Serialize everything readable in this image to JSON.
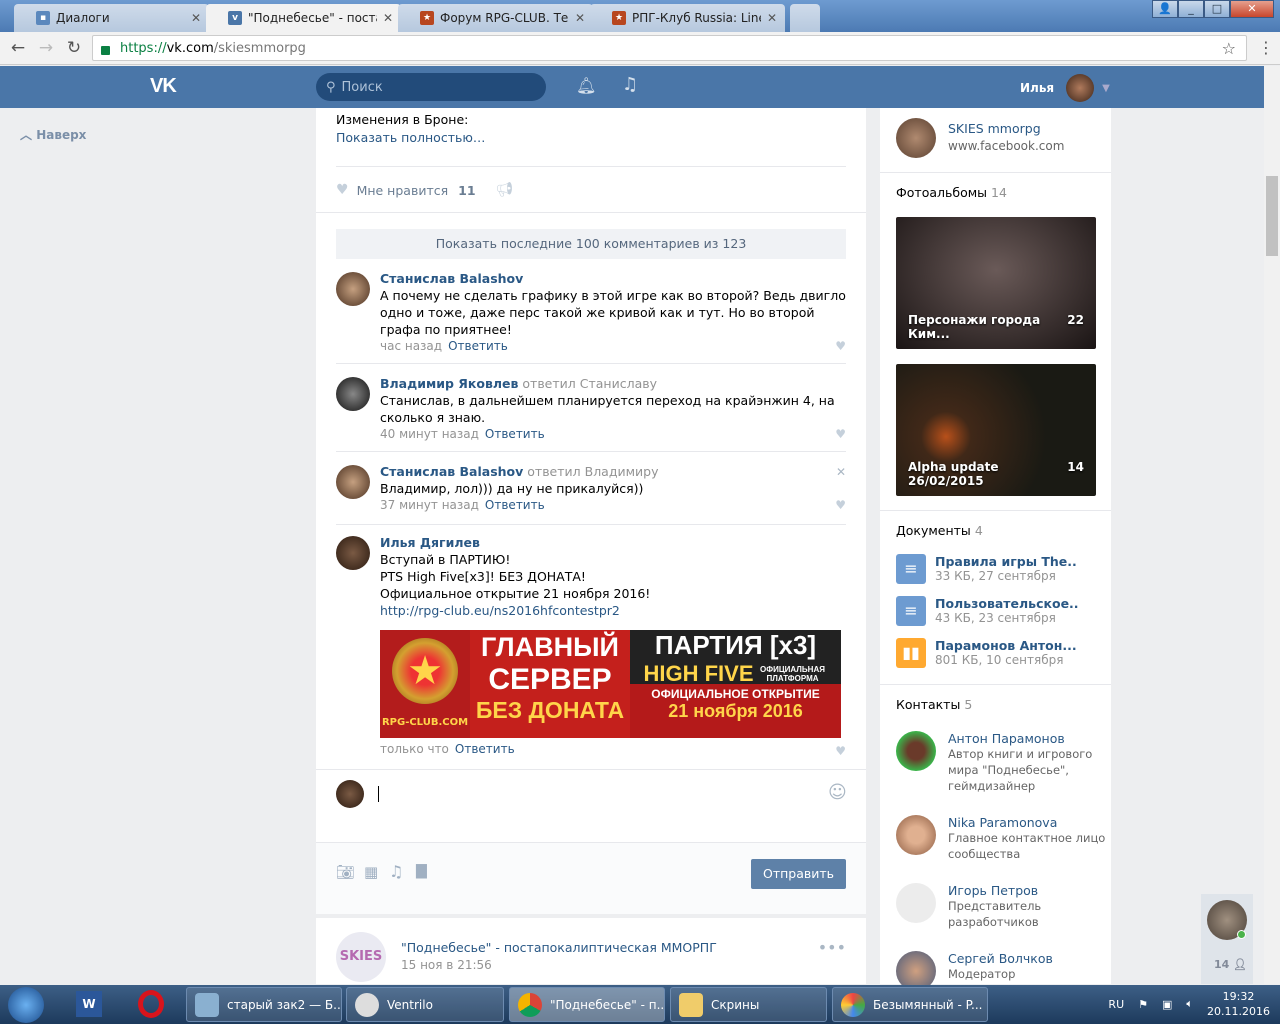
{
  "browser": {
    "tabs": [
      {
        "title": "Диалоги",
        "active": false
      },
      {
        "title": "\"Поднебесье\" - постапо",
        "active": true
      },
      {
        "title": "Форум RPG-CLUB. Тема",
        "active": false
      },
      {
        "title": "РПГ-Клуб Russia: Lineage",
        "active": false
      }
    ],
    "url": {
      "scheme": "https://",
      "host": "vk.com",
      "path": "/skiesmmorpg"
    }
  },
  "header": {
    "logo": "VK",
    "search_placeholder": "Поиск",
    "user_name": "Илья"
  },
  "left": {
    "back_label": "Наверх"
  },
  "post": {
    "text": "Изменения в Броне:",
    "show_full": "Показать полностью…",
    "like_label": "Мне нравится",
    "like_count": "11",
    "show_comments": "Показать последние 100 комментариев из 123"
  },
  "comments": [
    {
      "author": "Станислав Balashov",
      "reply_to": "",
      "text": "А почему не сделать графику в этой игре как во второй? Ведь двигло одно и тоже, даже перс такой же кривой как и тут. Но во второй графа по приятнее!",
      "time": "час назад",
      "reply": "Ответить"
    },
    {
      "author": "Владимир Яковлев",
      "reply_to": "ответил Станиславу",
      "text": "Станислав, в дальнейшем планируется переход на крайэнжин 4, на сколько я знаю.",
      "time": "40 минут назад",
      "reply": "Ответить"
    },
    {
      "author": "Станислав Balashov",
      "reply_to": "ответил Владимиру",
      "text": "Владимир, лол))) да ну не прикалуйся))",
      "time": "37 минут назад",
      "reply": "Ответить"
    },
    {
      "author": "Илья Дягилев",
      "reply_to": "",
      "lines": [
        "Вступай в ПАРТИЮ!",
        "PTS High Five[x3]! БЕЗ ДОНАТА!",
        "Официальное открытие 21 ноября 2016!"
      ],
      "link": "http://rpg-club.eu/ns2016hfcontestpr2",
      "time": "только что",
      "reply": "Ответить",
      "banner": {
        "site": "RPG-CLUB.COM",
        "l1": "ГЛАВНЫЙ",
        "l2": "СЕРВЕР",
        "l3": "БЕЗ ДОНАТА",
        "r1": "ПАРТИЯ [x3]",
        "r2": "HIGH FIVE",
        "r2b": "ОФИЦИАЛЬНАЯ ПЛАТФОРМА",
        "r3": "ОФИЦИАЛЬНОЕ ОТКРЫТИЕ",
        "r4": "21 ноября 2016"
      }
    }
  ],
  "composer": {
    "send": "Отправить"
  },
  "next_post": {
    "title": "\"Поднебесье\" - постапокалиптическая ММОРПГ",
    "date": "15 ноя в 21:56"
  },
  "right": {
    "link": {
      "title": "SKIES mmorpg",
      "url": "www.facebook.com"
    },
    "albums": {
      "label": "Фотоальбомы",
      "count": "14",
      "items": [
        {
          "title": "Персонажи города Ким...",
          "count": "22"
        },
        {
          "title": "Alpha update 26/02/2015",
          "count": "14"
        }
      ]
    },
    "docs": {
      "label": "Документы",
      "count": "4",
      "items": [
        {
          "title": "Правила игры The..",
          "meta": "33 КБ, 27 сентября"
        },
        {
          "title": "Пользовательское..",
          "meta": "43 КБ, 23 сентября"
        },
        {
          "title": "Парамонов Антон...",
          "meta": "801 КБ, 10 сентября"
        }
      ]
    },
    "contacts": {
      "label": "Контакты",
      "count": "5",
      "items": [
        {
          "name": "Антон Парамонов",
          "desc": "Автор книги и игрового мира \"Поднебесье\", геймдизайнер"
        },
        {
          "name": "Nika Paramonova",
          "desc": "Главное контактное лицо сообщества"
        },
        {
          "name": "Игорь Петров",
          "desc": "Представитель разработчиков"
        },
        {
          "name": "Сергей Волчков",
          "desc": "Модератор"
        }
      ]
    }
  },
  "online_friends": "14",
  "taskbar": {
    "items": [
      "старый зак2 — Б...",
      "Ventrilo",
      "\"Поднебесье\" - п...",
      "Скрины",
      "Безымянный - P..."
    ],
    "lang": "RU",
    "time": "19:32",
    "date": "20.11.2016"
  }
}
